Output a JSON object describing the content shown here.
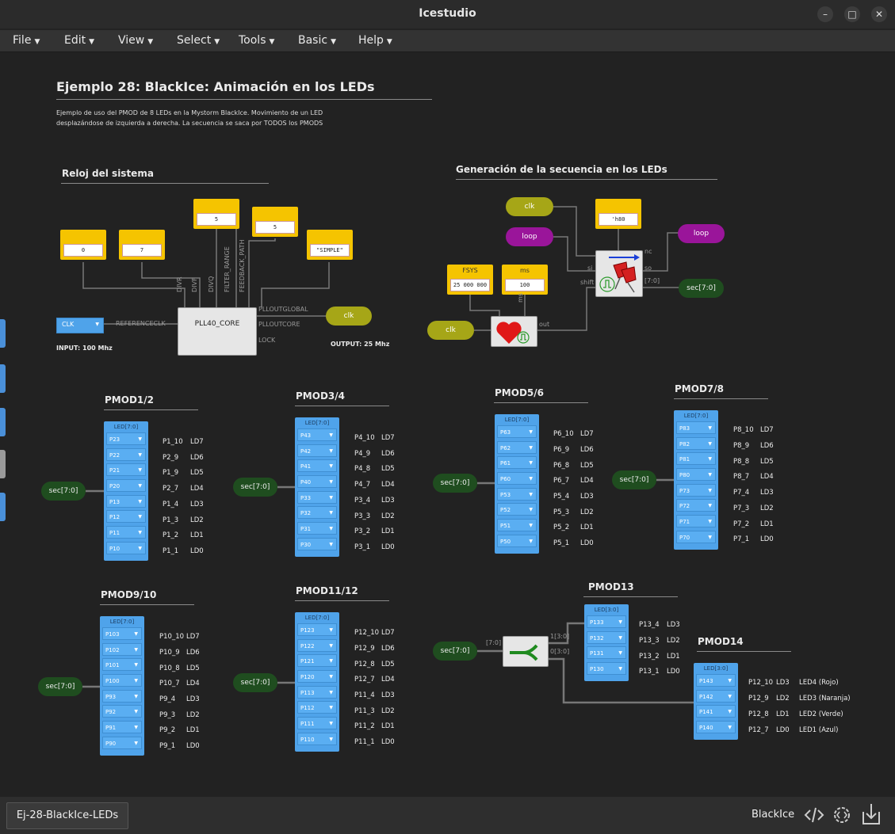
{
  "window": {
    "title": "Icestudio"
  },
  "menu": [
    {
      "label": "File"
    },
    {
      "label": "Edit"
    },
    {
      "label": "View"
    },
    {
      "label": "Select"
    },
    {
      "label": "Tools"
    },
    {
      "label": "Basic"
    },
    {
      "label": "Help"
    }
  ],
  "design": {
    "title": "Ejemplo 28: BlackIce: Animación en los LEDs",
    "desc_line1": "Ejemplo de uso del PMOD de 8 LEDs en la Mystorm BlackIce. Movimiento de un LED",
    "desc_line2": "desplazándose de izquierda a derecha. La secuencia se saca por TODOS los PMODS"
  },
  "clock_section": {
    "heading": "Reloj del sistema",
    "consts": [
      "0",
      "7",
      "5",
      "5",
      "\"SIMPLE\""
    ],
    "pll_name": "PLL40_CORE",
    "pll_ports_in": [
      "DIVR",
      "DIVF",
      "DIVQ",
      "FILTER_RANGE",
      "FEEDBACK_PATH"
    ],
    "ref_label": "REFERENCECLK",
    "out_ports": [
      "PLLOUTGLOBAL",
      "PLLOUTCORE",
      "LOCK"
    ],
    "clk_select": "CLK",
    "input_note": "INPUT: 100 Mhz",
    "output_note": "OUTPUT: 25 Mhz",
    "clk_out": "clk"
  },
  "seq_section": {
    "heading": "Generación de la secuencia en los LEDs",
    "clk1": "clk",
    "loop_in": "loop",
    "loop_out": "loop",
    "clk2": "clk",
    "const_h80": "'h80",
    "fsys_label": "FSYS",
    "fsys_value": "25 000 000",
    "ms_label": "ms",
    "ms_value": "100",
    "port_nc": "nc",
    "port_si": "si",
    "port_so": "so",
    "port_shift": "shift",
    "bus_label": "[7:0]",
    "port_out": "out",
    "port_ms": "ms",
    "sec_out": "sec[7:0]"
  },
  "pmods": [
    {
      "title": "PMOD1/2",
      "header": "LED[7:0]",
      "sec": "sec[7:0]",
      "rows": [
        [
          "P23",
          "P1_10",
          "LD7"
        ],
        [
          "P22",
          "P2_9",
          "LD6"
        ],
        [
          "P21",
          "P1_9",
          "LD5"
        ],
        [
          "P20",
          "P2_7",
          "LD4"
        ],
        [
          "P13",
          "P1_4",
          "LD3"
        ],
        [
          "P12",
          "P1_3",
          "LD2"
        ],
        [
          "P11",
          "P1_2",
          "LD1"
        ],
        [
          "P10",
          "P1_1",
          "LD0"
        ]
      ]
    },
    {
      "title": "PMOD3/4",
      "header": "LED[7:0]",
      "sec": "sec[7:0]",
      "rows": [
        [
          "P43",
          "P4_10",
          "LD7"
        ],
        [
          "P42",
          "P4_9",
          "LD6"
        ],
        [
          "P41",
          "P4_8",
          "LD5"
        ],
        [
          "P40",
          "P4_7",
          "LD4"
        ],
        [
          "P33",
          "P3_4",
          "LD3"
        ],
        [
          "P32",
          "P3_3",
          "LD2"
        ],
        [
          "P31",
          "P3_2",
          "LD1"
        ],
        [
          "P30",
          "P3_1",
          "LD0"
        ]
      ]
    },
    {
      "title": "PMOD5/6",
      "header": "LED[7:0]",
      "sec": "sec[7:0]",
      "rows": [
        [
          "P63",
          "P6_10",
          "LD7"
        ],
        [
          "P62",
          "P6_9",
          "LD6"
        ],
        [
          "P61",
          "P6_8",
          "LD5"
        ],
        [
          "P60",
          "P6_7",
          "LD4"
        ],
        [
          "P53",
          "P5_4",
          "LD3"
        ],
        [
          "P52",
          "P5_3",
          "LD2"
        ],
        [
          "P51",
          "P5_2",
          "LD1"
        ],
        [
          "P50",
          "P5_1",
          "LD0"
        ]
      ]
    },
    {
      "title": "PMOD7/8",
      "header": "LED[7:0]",
      "sec": "sec[7:0]",
      "rows": [
        [
          "P83",
          "P8_10",
          "LD7"
        ],
        [
          "P82",
          "P8_9",
          "LD6"
        ],
        [
          "P81",
          "P8_8",
          "LD5"
        ],
        [
          "P80",
          "P8_7",
          "LD4"
        ],
        [
          "P73",
          "P7_4",
          "LD3"
        ],
        [
          "P72",
          "P7_3",
          "LD2"
        ],
        [
          "P71",
          "P7_2",
          "LD1"
        ],
        [
          "P70",
          "P7_1",
          "LD0"
        ]
      ]
    },
    {
      "title": "PMOD9/10",
      "header": "LED[7:0]",
      "sec": "sec[7:0]",
      "rows": [
        [
          "P103",
          "P10_10",
          "LD7"
        ],
        [
          "P102",
          "P10_9",
          "LD6"
        ],
        [
          "P101",
          "P10_8",
          "LD5"
        ],
        [
          "P100",
          "P10_7",
          "LD4"
        ],
        [
          "P93",
          "P9_4",
          "LD3"
        ],
        [
          "P92",
          "P9_3",
          "LD2"
        ],
        [
          "P91",
          "P9_2",
          "LD1"
        ],
        [
          "P90",
          "P9_1",
          "LD0"
        ]
      ]
    },
    {
      "title": "PMOD11/12",
      "header": "LED[7:0]",
      "sec": "sec[7:0]",
      "rows": [
        [
          "P123",
          "P12_10",
          "LD7"
        ],
        [
          "P122",
          "P12_9",
          "LD6"
        ],
        [
          "P121",
          "P12_8",
          "LD5"
        ],
        [
          "P120",
          "P12_7",
          "LD4"
        ],
        [
          "P113",
          "P11_4",
          "LD3"
        ],
        [
          "P112",
          "P11_3",
          "LD2"
        ],
        [
          "P111",
          "P11_2",
          "LD1"
        ],
        [
          "P110",
          "P11_1",
          "LD0"
        ]
      ]
    },
    {
      "title": "PMOD13",
      "header": "LED[3:0]",
      "rows": [
        [
          "P133",
          "P13_4",
          "LD3"
        ],
        [
          "P132",
          "P13_3",
          "LD2"
        ],
        [
          "P131",
          "P13_2",
          "LD1"
        ],
        [
          "P130",
          "P13_1",
          "LD0"
        ]
      ]
    },
    {
      "title": "PMOD14",
      "header": "LED[3:0]",
      "rows": [
        [
          "P143",
          "P12_10",
          "LD3",
          "LED4 (Rojo)"
        ],
        [
          "P142",
          "P12_9",
          "LD2",
          "LED3 (Naranja)"
        ],
        [
          "P141",
          "P12_8",
          "LD1",
          "LED2 (Verde)"
        ],
        [
          "P140",
          "P12_7",
          "LD0",
          "LED1 (Azul)"
        ]
      ]
    }
  ],
  "splitter": {
    "sec": "sec[7:0]",
    "in": "[7:0]",
    "out_hi": "1[3:0]",
    "out_lo": "0[3:0]"
  },
  "footer": {
    "tab": "Ej-28-BlackIce-LEDs",
    "board": "BlackIce"
  }
}
